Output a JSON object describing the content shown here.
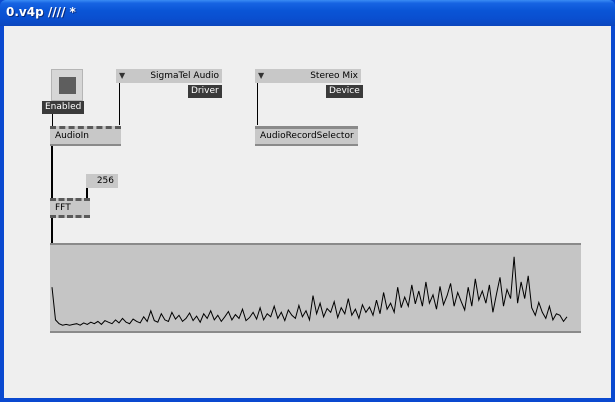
{
  "window": {
    "title": "0.v4p //// *"
  },
  "nodes": {
    "toggle": {
      "label": "Enabled"
    },
    "driver_enum": {
      "value": "SigmaTel Audio",
      "badge": "Driver"
    },
    "device_enum": {
      "value": "Stereo Mix",
      "badge": "Device"
    },
    "audioin": {
      "label": "AudioIn"
    },
    "recordselector": {
      "label": "AudioRecordSelector"
    },
    "fft_size": {
      "value": "256"
    },
    "fft": {
      "label": "FFT"
    }
  },
  "spectrum": {
    "color_bg": "#c5c5c5",
    "color_line": "#000000",
    "values": [
      0.55,
      0.12,
      0.07,
      0.05,
      0.06,
      0.05,
      0.06,
      0.07,
      0.05,
      0.08,
      0.06,
      0.09,
      0.07,
      0.1,
      0.06,
      0.11,
      0.09,
      0.07,
      0.12,
      0.08,
      0.14,
      0.09,
      0.07,
      0.13,
      0.1,
      0.08,
      0.16,
      0.1,
      0.24,
      0.11,
      0.09,
      0.2,
      0.12,
      0.1,
      0.22,
      0.13,
      0.18,
      0.1,
      0.14,
      0.21,
      0.11,
      0.17,
      0.09,
      0.2,
      0.14,
      0.24,
      0.12,
      0.18,
      0.1,
      0.16,
      0.23,
      0.12,
      0.19,
      0.14,
      0.26,
      0.11,
      0.15,
      0.22,
      0.13,
      0.28,
      0.12,
      0.2,
      0.16,
      0.3,
      0.14,
      0.22,
      0.11,
      0.25,
      0.18,
      0.14,
      0.31,
      0.16,
      0.24,
      0.12,
      0.44,
      0.2,
      0.34,
      0.16,
      0.27,
      0.22,
      0.36,
      0.15,
      0.28,
      0.2,
      0.4,
      0.18,
      0.26,
      0.14,
      0.32,
      0.22,
      0.29,
      0.18,
      0.38,
      0.2,
      0.48,
      0.26,
      0.34,
      0.22,
      0.55,
      0.28,
      0.42,
      0.3,
      0.58,
      0.33,
      0.5,
      0.3,
      0.62,
      0.34,
      0.45,
      0.26,
      0.56,
      0.32,
      0.44,
      0.6,
      0.3,
      0.48,
      0.36,
      0.25,
      0.55,
      0.3,
      0.66,
      0.38,
      0.5,
      0.34,
      0.58,
      0.22,
      0.46,
      0.68,
      0.3,
      0.52,
      0.4,
      0.95,
      0.34,
      0.62,
      0.4,
      0.7,
      0.28,
      0.18,
      0.35,
      0.22,
      0.14,
      0.3,
      0.12,
      0.2,
      0.18,
      0.1,
      0.16
    ]
  }
}
